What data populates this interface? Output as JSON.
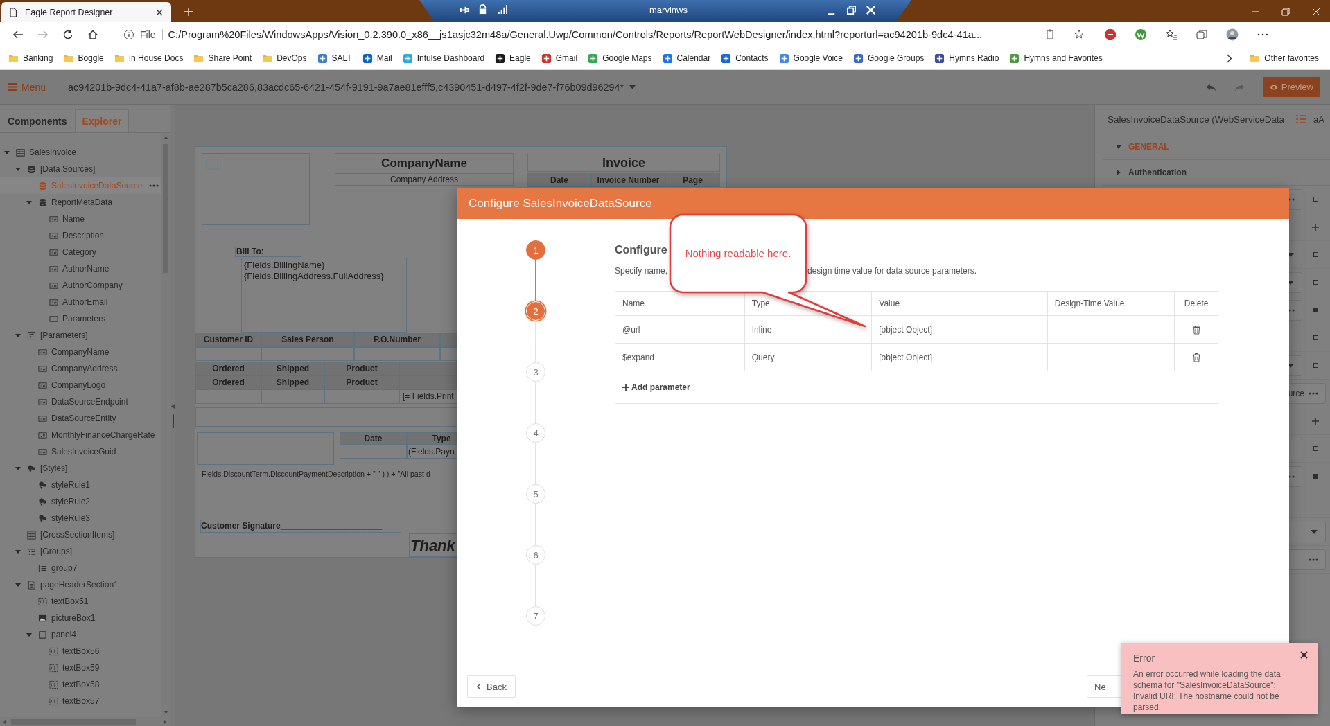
{
  "browser": {
    "tab": {
      "title": "Eagle Report Designer"
    },
    "remote_bar": {
      "title": "marvinws"
    },
    "address": {
      "scheme": "File",
      "url": "C:/Program%20Files/WindowsApps/Vision_0.2.390.0_x86__js1asjc32m48a/General.Uwp/Common/Controls/Reports/ReportWebDesigner/index.html?reporturl=ac94201b-9dc4-41a..."
    },
    "bookmarks": [
      {
        "label": "Banking",
        "kind": "folder"
      },
      {
        "label": "Boggle",
        "kind": "folder"
      },
      {
        "label": "In House Docs",
        "kind": "folder"
      },
      {
        "label": "Share Point",
        "kind": "folder"
      },
      {
        "label": "DevOps",
        "kind": "folder"
      },
      {
        "label": "SALT",
        "kind": "site",
        "color": "#3a7fd6"
      },
      {
        "label": "Mail",
        "kind": "site",
        "color": "#0a64c8"
      },
      {
        "label": "Intulse Dashboard",
        "kind": "site",
        "color": "#2ea7e0"
      },
      {
        "label": "Eagle",
        "kind": "site",
        "color": "#1a1a1a"
      },
      {
        "label": "Gmail",
        "kind": "site",
        "color": "#d93025"
      },
      {
        "label": "Google Maps",
        "kind": "site",
        "color": "#34a853"
      },
      {
        "label": "Calendar",
        "kind": "site",
        "color": "#1a73e8"
      },
      {
        "label": "Contacts",
        "kind": "site",
        "color": "#1967d2"
      },
      {
        "label": "Google Voice",
        "kind": "site",
        "color": "#4285f4"
      },
      {
        "label": "Google Groups",
        "kind": "site",
        "color": "#3367d6"
      },
      {
        "label": "Hymns Radio",
        "kind": "site",
        "color": "#3d4d9b"
      },
      {
        "label": "Hymns and Favorites",
        "kind": "site",
        "color": "#4a9a3a"
      }
    ],
    "other_favorites": "Other favorites"
  },
  "toolbar": {
    "menu": "Menu",
    "document": "ac94201b-9dc4-41a7-af8b-ae287b5ca286,83acdc65-6421-454f-9191-9a7ae81efff5,c4390451-d497-4f2f-9de7-f76b09d96294*",
    "preview": "Preview"
  },
  "left_panel": {
    "tabs": [
      {
        "label": "Components",
        "selected": false
      },
      {
        "label": "Explorer",
        "selected": true
      }
    ],
    "tree": [
      {
        "label": "SalesInvoice",
        "kind": "report",
        "expanded": true,
        "selected": false,
        "children": [
          {
            "label": "[Data Sources]",
            "kind": "database",
            "expanded": true,
            "selected": false,
            "children": [
              {
                "label": "SalesInvoiceDataSource",
                "kind": "datasource",
                "selected": true
              },
              {
                "label": "ReportMetaData",
                "kind": "database",
                "expanded": true,
                "selected": false,
                "children": [
                  {
                    "label": "Name",
                    "kind": "field",
                    "selected": false
                  },
                  {
                    "label": "Description",
                    "kind": "field",
                    "selected": false
                  },
                  {
                    "label": "Category",
                    "kind": "field",
                    "selected": false
                  },
                  {
                    "label": "AuthorName",
                    "kind": "field",
                    "selected": false
                  },
                  {
                    "label": "AuthorCompany",
                    "kind": "field",
                    "selected": false
                  },
                  {
                    "label": "AuthorEmail",
                    "kind": "field",
                    "selected": false
                  },
                  {
                    "label": "Parameters",
                    "kind": "list",
                    "selected": false
                  }
                ]
              }
            ]
          },
          {
            "label": "[Parameters]",
            "kind": "parameters",
            "expanded": true,
            "selected": false,
            "children": [
              {
                "label": "CompanyName",
                "kind": "field",
                "selected": false
              },
              {
                "label": "CompanyAddress",
                "kind": "field",
                "selected": false
              },
              {
                "label": "CompanyLogo",
                "kind": "field",
                "selected": false
              },
              {
                "label": "DataSourceEndpoint",
                "kind": "field",
                "selected": false
              },
              {
                "label": "DataSourceEntity",
                "kind": "field",
                "selected": false
              },
              {
                "label": "MonthlyFinanceChargeRate",
                "kind": "number",
                "selected": false
              },
              {
                "label": "SalesInvoiceGuid",
                "kind": "field",
                "selected": false
              }
            ]
          },
          {
            "label": "[Styles]",
            "kind": "style",
            "expanded": true,
            "selected": false,
            "children": [
              {
                "label": "styleRule1",
                "kind": "style",
                "selected": false
              },
              {
                "label": "styleRule2",
                "kind": "style",
                "selected": false
              },
              {
                "label": "styleRule3",
                "kind": "style",
                "selected": false
              }
            ]
          },
          {
            "label": "[CrossSectionItems]",
            "kind": "grid",
            "selected": false
          },
          {
            "label": "[Groups]",
            "kind": "groups",
            "expanded": true,
            "selected": false,
            "children": [
              {
                "label": "group7",
                "kind": "group",
                "selected": false
              }
            ]
          },
          {
            "label": "pageHeaderSection1",
            "kind": "section",
            "expanded": true,
            "selected": false,
            "children": [
              {
                "label": "textBox51",
                "kind": "textbox",
                "selected": false
              },
              {
                "label": "pictureBox1",
                "kind": "picture",
                "selected": false
              },
              {
                "label": "panel4",
                "kind": "panel",
                "expanded": true,
                "selected": false,
                "children": [
                  {
                    "label": "textBox56",
                    "kind": "textbox",
                    "selected": false
                  },
                  {
                    "label": "textBox59",
                    "kind": "textbox",
                    "selected": false
                  },
                  {
                    "label": "textBox58",
                    "kind": "textbox",
                    "selected": false
                  },
                  {
                    "label": "textBox57",
                    "kind": "textbox",
                    "selected": false
                  }
                ]
              }
            ]
          }
        ]
      }
    ]
  },
  "report": {
    "company_name": "CompanyName",
    "company_address": "Company Address",
    "invoice_title": "Invoice",
    "invoice_columns": [
      "Date",
      "Invoice Number",
      "Page"
    ],
    "bill_to": "Bill To:",
    "billing_lines": [
      "{Fields.BillingName}",
      "{Fields.BillingAddress.FullAddress}"
    ],
    "customer_columns": [
      "Customer ID",
      "Sales Person",
      "P.O.Number"
    ],
    "item_header_rows": [
      [
        "Ordered",
        "Shipped",
        "Product"
      ],
      [
        "Ordered",
        "Shipped",
        "Product"
      ]
    ],
    "item_cell": "[= Fields.Print",
    "payment_columns": [
      "Date",
      "Type"
    ],
    "payment_cell": "(Fields.Payn",
    "discount_text": "Fields.DiscountTerm.DiscountPaymentDescription + \" \" ) ) + \"All past d",
    "signature": "Customer Signature______________________",
    "thanks": "Thank"
  },
  "properties": {
    "title": "SalesInvoiceDataSource (WebServiceData",
    "font_toggle": "aA",
    "sections": [
      {
        "label": "GENERAL",
        "kind": "category",
        "expanded": true
      },
      {
        "label": "Authentication",
        "kind": "group",
        "expanded": false
      }
    ],
    "rows": [
      {
        "kind": "more",
        "modified": false
      },
      {
        "kind": "add"
      },
      {
        "kind": "dropdown",
        "modified": false
      },
      {
        "kind": "dropdown",
        "modified": false
      },
      {
        "kind": "more",
        "modified": true
      },
      {
        "kind": "square",
        "modified": false
      },
      {
        "kind": "dropdown",
        "modified": false
      },
      {
        "kind": "text-more",
        "value": "urce"
      },
      {
        "kind": "add"
      },
      {
        "kind": "field",
        "modified": false
      },
      {
        "kind": "more",
        "modified": true
      },
      {
        "kind": "blank"
      },
      {
        "kind": "dropdown-wide"
      },
      {
        "kind": "more-wide"
      }
    ]
  },
  "dialog": {
    "title": "Configure SalesInvoiceDataSource",
    "steps": [
      {
        "label": "1",
        "completed": true,
        "selected": false
      },
      {
        "label": "2",
        "completed": false,
        "selected": true
      },
      {
        "label": "3",
        "completed": false,
        "selected": false
      },
      {
        "label": "4",
        "completed": false,
        "selected": false
      },
      {
        "label": "5",
        "completed": false,
        "selected": false
      },
      {
        "label": "6",
        "completed": false,
        "selected": false
      },
      {
        "label": "7",
        "completed": false,
        "selected": false
      }
    ],
    "heading": "Configure",
    "subtitle_start": "Specify name,",
    "subtitle_end": "design time value for data source parameters.",
    "columns": [
      "Name",
      "Type",
      "Value",
      "Design-Time Value",
      "Delete"
    ],
    "rows": [
      {
        "name": "@url",
        "type": "Inline",
        "value": "[object Object]"
      },
      {
        "name": "$expand",
        "type": "Query",
        "value": "[object Object]"
      }
    ],
    "add_parameter": "Add parameter",
    "back": "Back",
    "next": "Ne"
  },
  "callout": {
    "text": "Nothing readable here."
  },
  "toast": {
    "title": "Error",
    "message": "An error occurred while loading the data schema for \"SalesInvoiceDataSource\": Invalid URI: The hostname could not be parsed."
  }
}
